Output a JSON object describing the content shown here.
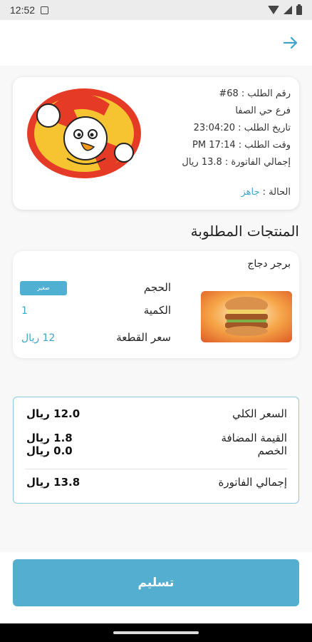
{
  "status_bar": {
    "time": "12:52",
    "icons": [
      "notification-icon",
      "wifi-icon",
      "signal-icon",
      "battery-icon"
    ]
  },
  "header": {
    "back_icon": "arrow-right-icon"
  },
  "order": {
    "number_line": "رقم الطلب : 68#",
    "branch_line": "فرع حي الصفا",
    "date_line": "تاريخ الطلب : 23:04:20",
    "time_line": "وقت الطلب : PM 17:14",
    "invoice_total_line": "إجمالي الفاتورة : 13.8 ريال",
    "status_label": "الحالة :",
    "status_value": "جاهز",
    "logo_icon": "restaurant-mascot-logo"
  },
  "products_section": {
    "title": "المنتجات المطلوبة"
  },
  "product": {
    "name": "برجر دجاج",
    "size_label": "الحجم",
    "size_value": "صغير",
    "quantity_label": "الكمية",
    "quantity_value": "1",
    "unit_price_label": "سعر القطعة",
    "unit_price_value": "12 ريال",
    "image_icon": "burger-image"
  },
  "totals": {
    "subtotal_label": "السعر الكلي",
    "subtotal_value": "12.0 ريال",
    "vat_label": "القيمة المضافة",
    "vat_value": "1.8 ريال",
    "discount_label": "الخصم",
    "discount_value": "0.0 ريال",
    "invoice_total_label": "إجمالي الفاتورة",
    "invoice_total_value": "13.8 ريال"
  },
  "actions": {
    "deliver_label": "تسليم"
  },
  "colors": {
    "accent": "#53aed0",
    "status_text": "#3fa4c9",
    "logo_red": "#e53a26",
    "logo_yellow": "#f7c431"
  }
}
